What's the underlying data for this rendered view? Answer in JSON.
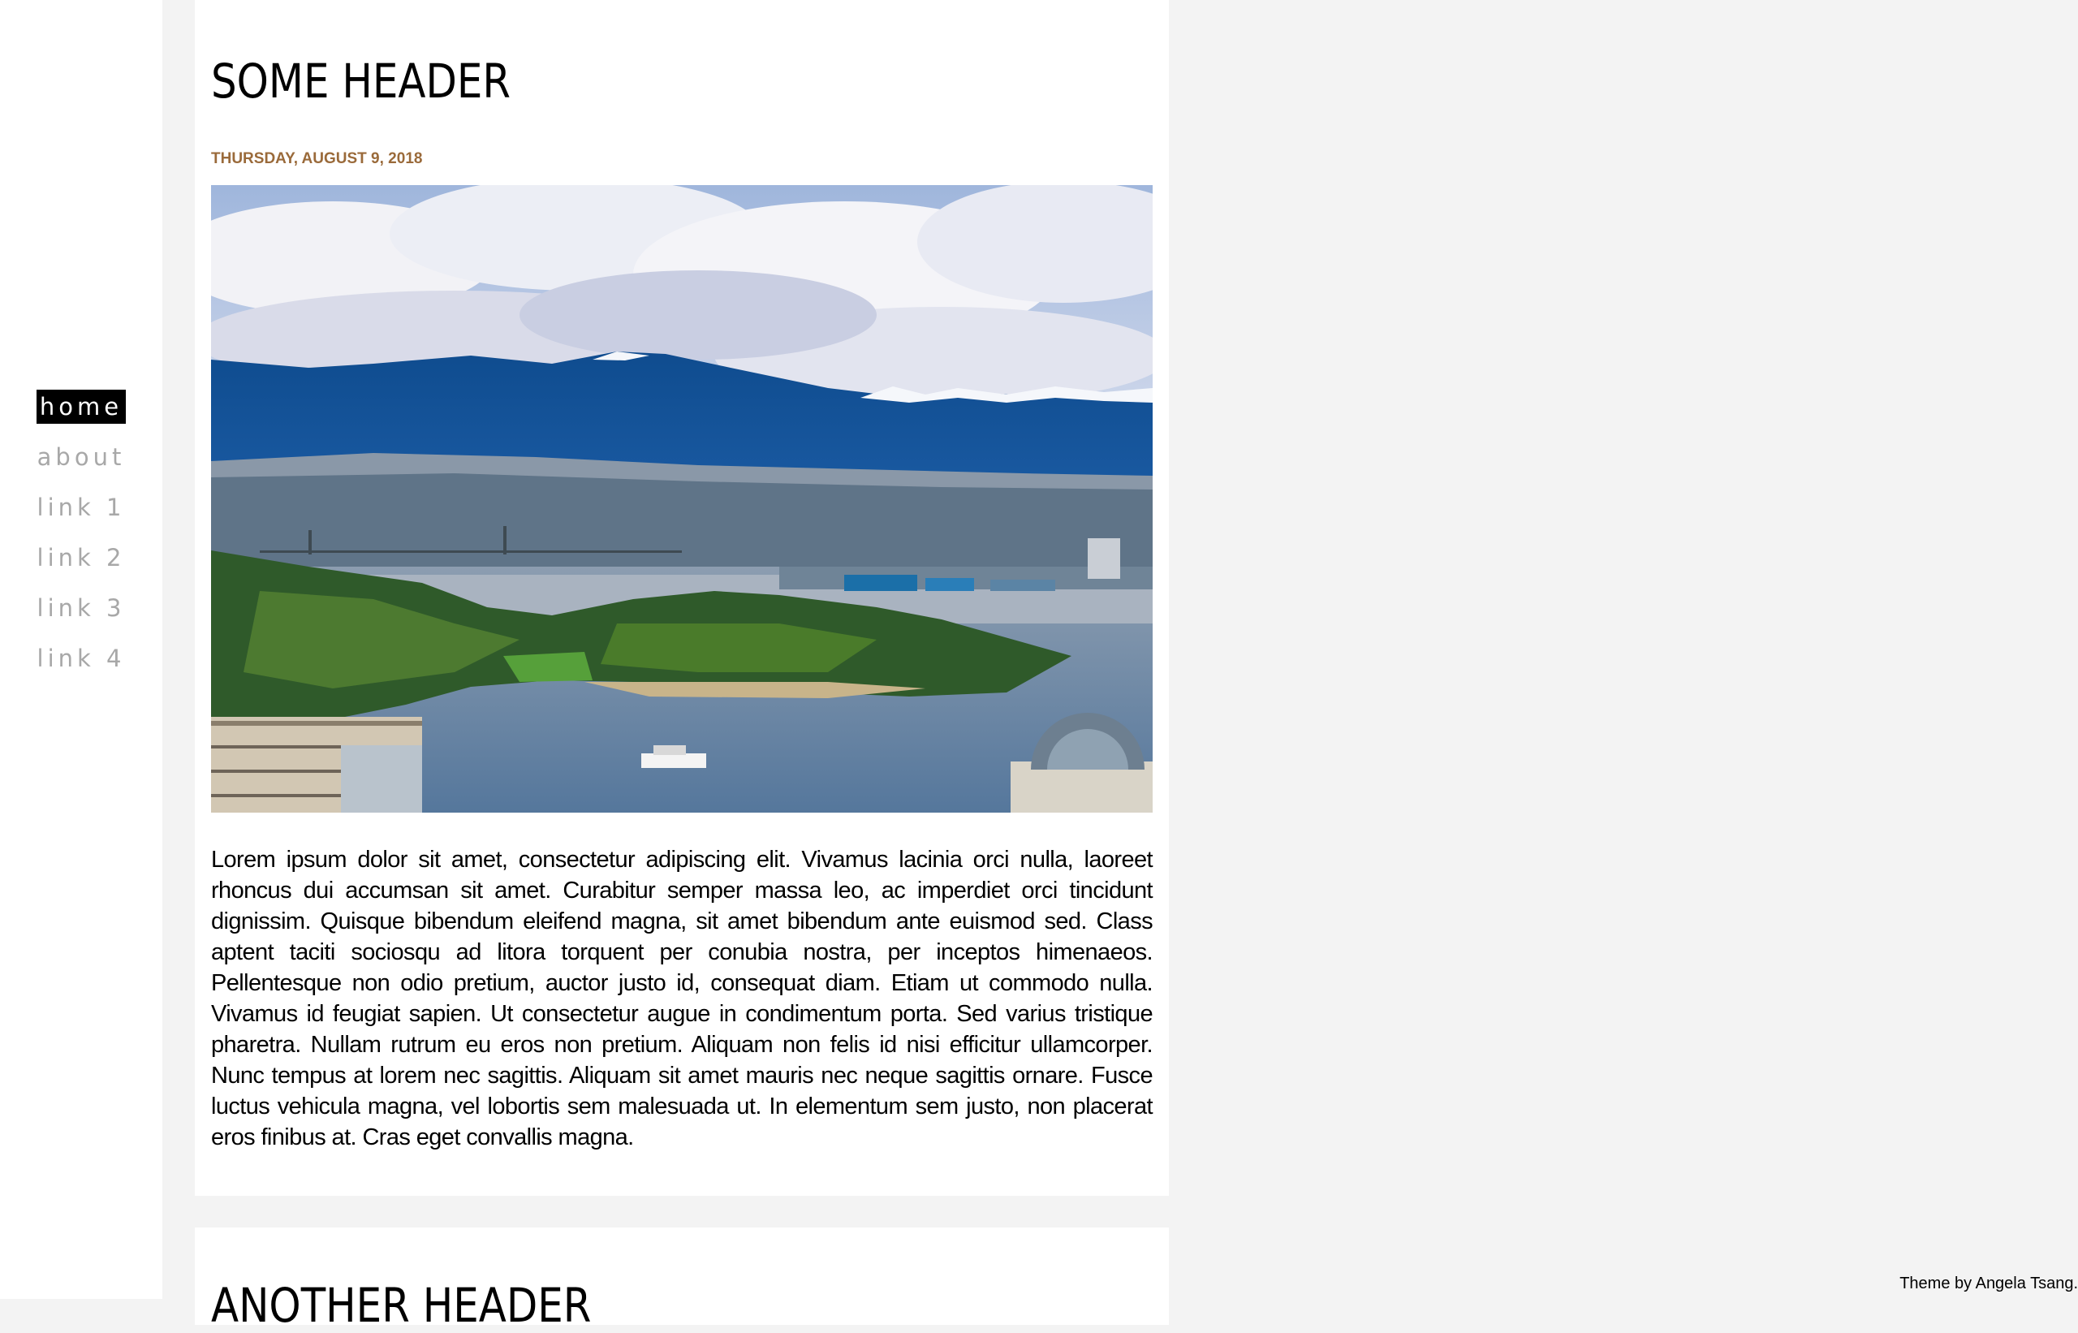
{
  "nav": {
    "items": [
      {
        "label": "home"
      },
      {
        "label": "about"
      },
      {
        "label": "link 1"
      },
      {
        "label": "link 2"
      },
      {
        "label": "link 3"
      },
      {
        "label": "link 4"
      }
    ]
  },
  "posts": [
    {
      "title": "SOME HEADER",
      "date": "THURSDAY, AUGUST 9, 2018",
      "image": "harbour-mountains-photo",
      "body": "Lorem ipsum dolor sit amet, consectetur adipiscing elit. Vivamus lacinia orci nulla, laoreet rhoncus dui accumsan sit amet. Curabitur semper massa leo, ac imperdiet orci tincidunt dignissim. Quisque bibendum eleifend magna, sit amet bibendum ante euismod sed. Class aptent taciti sociosqu ad litora torquent per conubia nostra, per inceptos himenaeos. Pellentesque non odio pretium, auctor justo id, consequat diam. Etiam ut commodo nulla. Vivamus id feugiat sapien. Ut consectetur augue in condimentum porta. Sed varius tristique pharetra. Nullam rutrum eu eros non pretium. Aliquam non felis id nisi efficitur ullamcorper. Nunc tempus at lorem nec sagittis. Aliquam sit amet mauris nec neque sagittis ornare. Fusce luctus vehicula magna, vel lobortis sem malesuada ut. In elementum sem justo, non placerat eros finibus at. Cras eget convallis magna."
    },
    {
      "title": "ANOTHER HEADER"
    }
  ],
  "footer": {
    "credit": "Theme by Angela Tsang."
  },
  "colors": {
    "page_background": "#f3f3f3",
    "date": "#9a6a3a",
    "nav_inactive": "#a8a8a8",
    "nav_active_bg": "#000000"
  }
}
